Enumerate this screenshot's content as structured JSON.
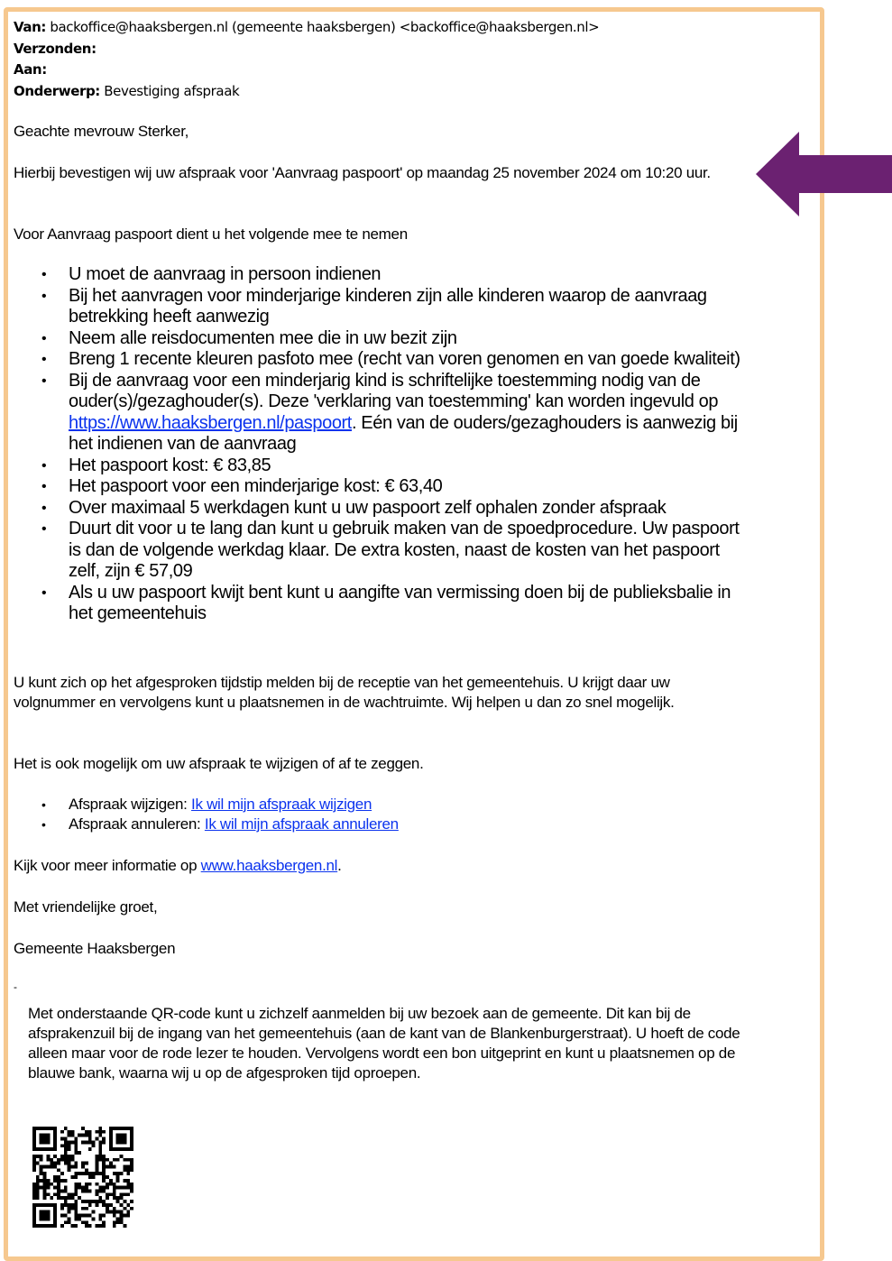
{
  "header": {
    "from_label": "Van:",
    "from_value": "backoffice@haaksbergen.nl (gemeente haaksbergen) <backoffice@haaksbergen.nl>",
    "sent_label": "Verzonden:",
    "to_label": "Aan:",
    "subject_label": "Onderwerp:",
    "subject_value": "Bevestiging afspraak"
  },
  "body": {
    "greeting": "Geachte mevrouw Sterker,",
    "confirmation": "Hierbij bevestigen wij uw afspraak voor 'Aanvraag paspoort' op maandag 25 november 2024 om 10:20 uur.",
    "bring_intro": "Voor Aanvraag paspoort dient u het volgende mee te nemen",
    "req": {
      "r1": "U moet de aanvraag in persoon indienen",
      "r2": "Bij het aanvragen voor minderjarige kinderen zijn alle kinderen waarop de aanvraag betrekking heeft aanwezig",
      "r3": "Neem alle reisdocumenten mee die in uw bezit zijn",
      "r4": "Breng 1 recente kleuren pasfoto mee (recht van voren genomen en van goede kwaliteit)",
      "r5_pre": "Bij de aanvraag voor een minderjarig kind is schriftelijke toestemming nodig van de ouder(s)/gezaghouder(s). Deze 'verklaring van toestemming' kan worden ingevuld op ",
      "r5_link": "https://www.haaksbergen.nl/paspoort",
      "r5_post": ". Eén van de ouders/gezaghouders is aanwezig bij het indienen van de aanvraag",
      "r6": "Het paspoort kost: € 83,85",
      "r7": "Het paspoort voor een minderjarige kost: € 63,40",
      "r8": "Over maximaal 5 werkdagen kunt u uw paspoort zelf ophalen zonder afspraak",
      "r9": "Duurt dit voor u te lang dan kunt u gebruik maken van de spoedprocedure. Uw paspoort is dan de volgende werkdag klaar. De extra kosten, naast de kosten van het paspoort zelf, zijn € 57,09",
      "r10": "Als u uw paspoort kwijt bent kunt u aangifte van vermissing doen bij de publieksbalie in het gemeentehuis"
    },
    "arrival": "U kunt zich op het afgesproken tijdstip melden bij de receptie van het gemeentehuis. U krijgt daar uw volgnummer en vervolgens kunt u plaatsnemen in de wachtruimte. Wij helpen u dan zo snel mogelijk.",
    "change_intro": "Het is ook mogelijk om uw afspraak te wijzigen of af te zeggen.",
    "change_label": "Afspraak wijzigen: ",
    "change_link": "Ik wil mijn afspraak wijzigen",
    "cancel_label": "Afspraak annuleren: ",
    "cancel_link": "Ik wil mijn afspraak annuleren",
    "more_pre": "Kijk voor meer informatie op ",
    "more_link": "www.haaksbergen.nl",
    "more_post": ".",
    "closing": "Met vriendelijke groet,",
    "signature": "Gemeente Haaksbergen",
    "dash": "-",
    "qr_text": "Met onderstaande QR-code kunt u zichzelf aanmelden bij uw bezoek aan de gemeente. Dit kan bij de afsprakenzuil bij de ingang van het gemeentehuis (aan de kant van de Blankenburgerstraat). U hoeft de code alleen maar voor de rode lezer te houden. Vervolgens wordt een bon uitgeprint en kunt u plaatsnemen op de blauwe bank, waarna wij u op de afgesproken tijd oproepen."
  },
  "colors": {
    "border": "#f6c88f",
    "arrow": "#6b2171",
    "link": "#0b33ee"
  },
  "icons": {
    "arrow": "arrow-left-icon",
    "qr": "qr-code-icon"
  }
}
